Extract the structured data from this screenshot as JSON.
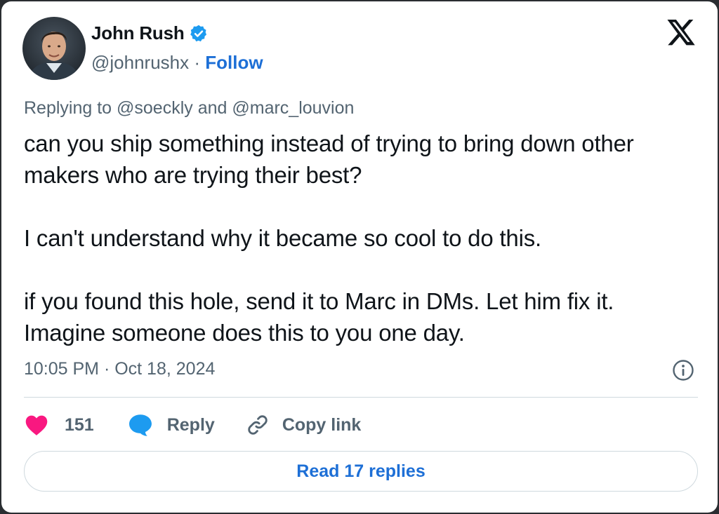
{
  "author": {
    "name": "John Rush",
    "handle": "@johnrushx",
    "separator": "·",
    "follow_label": "Follow",
    "verified": true,
    "verified_color": "#1d9bf0"
  },
  "tweet": {
    "replying_to": "Replying to @soeckly and @marc_louvion",
    "paragraphs": [
      "can you ship something instead of trying to bring down other makers who are trying their best?",
      "I can't understand why it became so cool to do this.",
      "if you found this hole, send it to Marc in DMs. Let him fix it. Imagine someone does this to you one day."
    ],
    "timestamp": "10:05 PM · Oct 18, 2024"
  },
  "actions": {
    "like_count": "151",
    "reply_label": "Reply",
    "copy_link_label": "Copy link"
  },
  "footer": {
    "read_replies_label": "Read 17 replies"
  },
  "icons": {
    "x_logo": "x-logo-icon",
    "info": "info-icon",
    "like": "heart-icon",
    "reply": "speech-bubble-icon",
    "copy_link": "link-icon",
    "verified": "verified-badge-icon"
  },
  "colors": {
    "link": "#1d6fd6",
    "like": "#f91880",
    "reply": "#1d9bf0",
    "muted": "#536471"
  }
}
